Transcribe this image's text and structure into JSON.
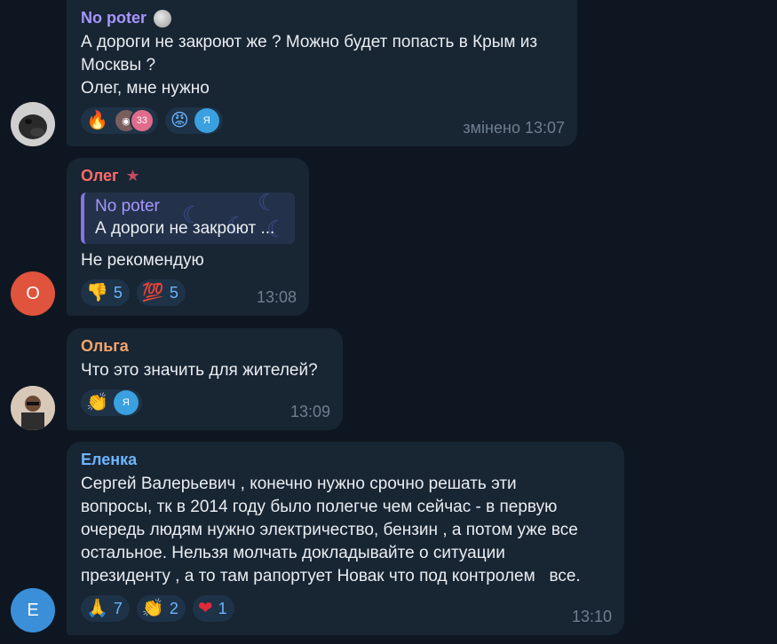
{
  "messages": [
    {
      "sender": "No poter",
      "sender_badge": "moon-icon",
      "text": "А дороги не закроют же ? Можно будет попасть в Крым из\nМосквы ?\nОлег, мне нужно",
      "reactions": [
        {
          "emoji": "🔥",
          "count": ""
        },
        {
          "emoji": "avatars",
          "count": "",
          "extra": "33"
        },
        {
          "emoji": "😡",
          "count": ""
        },
        {
          "emoji": "avatar",
          "count": "",
          "extra": "Я"
        }
      ],
      "time": "змінено 13:07",
      "sender_color": "#a696ff"
    },
    {
      "sender": "Олег",
      "sender_badge": "star-icon",
      "reply": {
        "name": "No poter",
        "text": "А дороги не закроют ..."
      },
      "text": "Не рекомендую",
      "reactions": [
        {
          "emoji": "👎",
          "count": "5"
        },
        {
          "emoji": "💯",
          "count": "5"
        }
      ],
      "time": "13:08",
      "avatar_letter": "О",
      "sender_color": "#ff6b6b"
    },
    {
      "sender": "Ольга",
      "text": "Что это значить для жителей?",
      "reactions": [
        {
          "emoji": "👏",
          "count": "",
          "extra": "Я"
        }
      ],
      "time": "13:09",
      "sender_color": "#f3a56b"
    },
    {
      "sender": "Еленка",
      "text": "Сергей Валерьевич , конечно нужно срочно решать эти\nвопросы, тк в 2014 году было полегче чем сейчас - в первую\nочередь людям нужно электричество, бензин , а потом уже все\nостальное. Нельзя молчать докладывайте о ситуации\nпрезиденту , а то там рапортует Новак что под контролем   все.",
      "reactions": [
        {
          "emoji": "🙏",
          "count": "7"
        },
        {
          "emoji": "👏",
          "count": "2"
        },
        {
          "emoji": "❤️",
          "count": "1"
        }
      ],
      "time": "13:10",
      "avatar_letter": "Е",
      "sender_color": "#6cb6ff"
    }
  ]
}
